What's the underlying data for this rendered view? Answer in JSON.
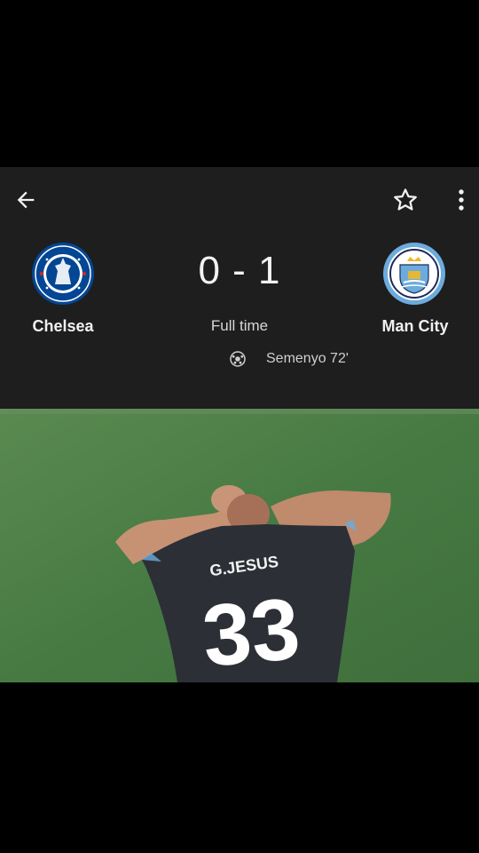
{
  "match": {
    "home": {
      "name": "Chelsea",
      "crest_icon": "chelsea-crest-icon",
      "color": "#034694"
    },
    "away": {
      "name": "Man City",
      "crest_icon": "man-city-crest-icon",
      "color": "#6cabdd"
    },
    "score_display": "0 - 1",
    "status": "Full time",
    "scorers": [
      {
        "text": "Semenyo 72'",
        "icon": "football-icon"
      }
    ]
  },
  "toolbar": {
    "back_icon": "back-arrow-icon",
    "favorite_icon": "star-icon",
    "more_icon": "more-vert-icon"
  },
  "media": {
    "jersey_name": "G.JESUS",
    "jersey_number": "33"
  },
  "colors": {
    "card_bg": "#1e1e1e",
    "pitch": "#4b7f47",
    "shirt": "#2c2f36"
  }
}
